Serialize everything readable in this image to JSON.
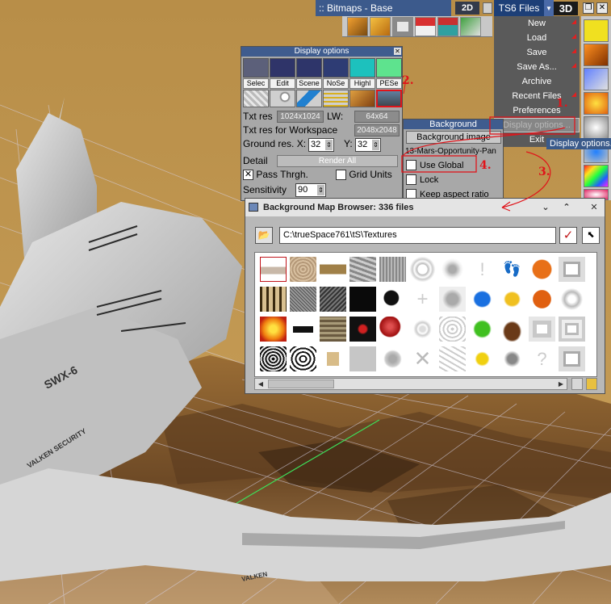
{
  "app": {
    "library_title": ":: Bitmaps - Base",
    "view2d_label": "2D",
    "files_menu_label": "TS6 Files",
    "view3d_label": "3D",
    "ship_text_model": "SWX-6",
    "ship_text_security": "VALKEN SECURITY",
    "ship_text_wing": "VALKEN"
  },
  "files_menu": {
    "items": [
      {
        "label": "New"
      },
      {
        "label": "Load"
      },
      {
        "label": "Save"
      },
      {
        "label": "Save As..."
      },
      {
        "label": "Archive"
      },
      {
        "label": "Recent Files"
      },
      {
        "label": "Preferences"
      },
      {
        "label": "Display options..."
      },
      {
        "label": "Exit"
      }
    ],
    "tooltip": "Display options..."
  },
  "display_options": {
    "title": "Display options",
    "swatch_labels": [
      "Selec",
      "Edit",
      "Scene",
      "NoSe",
      "Highl",
      "PESe"
    ],
    "swatch_colors": [
      "#5c607a",
      "#2f3469",
      "#2e356a",
      "#2e3c74",
      "#1dc1bd",
      "#5ee38e"
    ],
    "txt_res_label": "Txt res",
    "txt_res_value": "1024x1024",
    "lw_label": "LW:",
    "lw_value": "64x64",
    "workspace_label": "Txt res for Workspace",
    "workspace_value": "2048x2048",
    "ground_label": "Ground res. X:",
    "ground_x": "32",
    "ground_y_label": "Y:",
    "ground_y": "32",
    "detail_label": "Detail",
    "render_all_label": "Render All",
    "pass_thrgh_label": "Pass Thrgh.",
    "grid_units_label": "Grid Units",
    "sensitivity_label": "Sensitivity",
    "sensitivity_value": "90"
  },
  "background_panel": {
    "title": "Background",
    "image_button": "Background image",
    "image_name": "13-Mars-Opportunity-Pan",
    "use_global_label": "Use Global",
    "lock_label": "Lock",
    "keep_aspect_label": "Keep aspect ratio"
  },
  "browser": {
    "title": "Background Map Browser: 336 files",
    "path": "C:\\trueSpace761\\tS\\Textures"
  },
  "annotations": {
    "step1": "1.",
    "step2": "2.",
    "step3": "3.",
    "step4": "4."
  },
  "colors": {
    "accent_red": "#e0141a",
    "title_blue": "#3f5c8e",
    "menu_bg": "#5a5a5a"
  }
}
